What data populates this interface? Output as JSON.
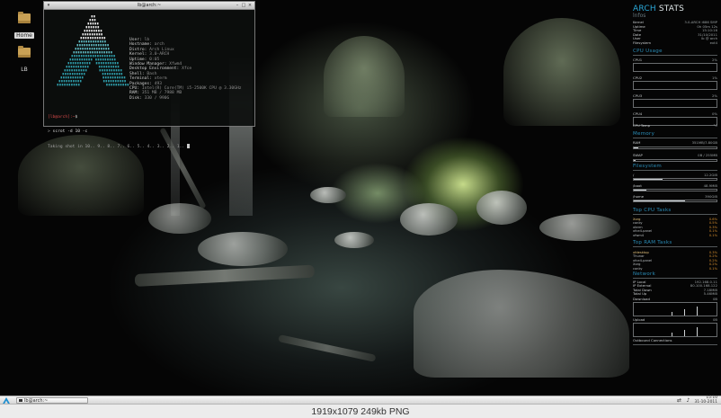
{
  "desktop": {
    "icons": [
      {
        "label": "Home"
      },
      {
        "label": "LB"
      }
    ]
  },
  "terminal": {
    "title": "lb@arch:~",
    "info": [
      {
        "key": "User:",
        "value": "lb"
      },
      {
        "key": "Hostname:",
        "value": "arch"
      },
      {
        "key": "Distro:",
        "value": "Arch Linux"
      },
      {
        "key": "Kernel:",
        "value": "3.0-ARCH"
      },
      {
        "key": "Uptime:",
        "value": "0:05"
      },
      {
        "key": "Window Manager:",
        "value": "Xfwm4"
      },
      {
        "key": "Desktop Environment:",
        "value": "Xfce"
      },
      {
        "key": "Shell:",
        "value": "Bash"
      },
      {
        "key": "Terminal:",
        "value": "xterm"
      },
      {
        "key": "Packages:",
        "value": "493"
      },
      {
        "key": "CPU:",
        "value": "Intel(R) Core(TM) i5-2500K CPU @ 3.30GHz"
      },
      {
        "key": "RAM:",
        "value": "351 MB / 7988 MB"
      },
      {
        "key": "Disk:",
        "value": "330 / 990G"
      }
    ],
    "prompt_user": "[lb@arch]:~",
    "prompt_symbol": "$",
    "command": "scrot -d 10 -c",
    "countdown": "Taking shot in 10.. 9.. 8.. 7.. 6.. 5.. 4.. 3.. 2.. 1.."
  },
  "stats": {
    "title_accent": "ARCH",
    "title_rest": "STATS",
    "host": "lnfos",
    "sys_rows": [
      {
        "k": "Kernel",
        "v": "3.0-ARCH i686 SMP"
      },
      {
        "k": "Uptime",
        "v": "0h 05m 12s"
      },
      {
        "k": "Time",
        "v": "15:10:16"
      },
      {
        "k": "Date",
        "v": "31/10/2011"
      },
      {
        "k": "User",
        "v": "lb @ arch"
      },
      {
        "k": "Filesystem",
        "v": "ext4"
      }
    ],
    "cpu_head": "CPU Usage",
    "cpu_rows": [
      {
        "k": "CPU1",
        "v": "2%"
      },
      {
        "k": "CPU2",
        "v": "1%"
      },
      {
        "k": "CPU3",
        "v": "2%"
      },
      {
        "k": "CPU4",
        "v": "0%"
      }
    ],
    "cpu_temp": {
      "k": "CPU Temp",
      "v": "°C"
    },
    "mem_head": "Memory",
    "mem_rows": [
      {
        "k": "RAM",
        "v": "351MB/7.80GB"
      },
      {
        "k": "SWAP",
        "v": "0B / 255MB"
      }
    ],
    "mem_fill": [
      0.05,
      0.0
    ],
    "fs_head": "Filesystem",
    "fs_rows": [
      {
        "k": "/",
        "v": "12.2GiB"
      },
      {
        "k": "/boot",
        "v": "48.9MiB"
      },
      {
        "k": "/home",
        "v": "390GiB"
      }
    ],
    "fs_fill": [
      0.35,
      0.15,
      0.62
    ],
    "cpu_tasks_head": "Top CPU Tasks",
    "cpu_tasks": [
      {
        "name": "Xorg",
        "pct": "0.6%"
      },
      {
        "name": "conky",
        "pct": "0.5%"
      },
      {
        "name": "xterm",
        "pct": "0.3%"
      },
      {
        "name": "xfce4-panel",
        "pct": "0.1%"
      },
      {
        "name": "xfwm4",
        "pct": "0.1%"
      }
    ],
    "mem_tasks_head": "Top RAM Tasks",
    "mem_tasks": [
      {
        "name": "xfdesktop",
        "pct": "0.3%"
      },
      {
        "name": "Thunar",
        "pct": "0.2%"
      },
      {
        "name": "xfce4-panel",
        "pct": "0.2%"
      },
      {
        "name": "Xorg",
        "pct": "0.2%"
      },
      {
        "name": "conky",
        "pct": "0.1%"
      }
    ],
    "net_head": "Network",
    "net_rows": [
      {
        "k": "IP Local",
        "v": "192.168.0.11"
      },
      {
        "k": "IP External",
        "v": "80.100.168.122"
      },
      {
        "k": "Total Down",
        "v": "7.18MiB"
      },
      {
        "k": "Total Up",
        "v": "5.46MiB"
      }
    ],
    "download": {
      "k": "Download",
      "v": "0B"
    },
    "upload": {
      "k": "Upload",
      "v": "0B"
    },
    "outbound": "Outbound Connections"
  },
  "taskbar": {
    "task_label": "lb@arch:~",
    "clock_time": "15:10",
    "clock_date": "31-10-2011"
  },
  "caption": "1919x1079  249kb  PNG",
  "icons": {
    "start": "arch-logo-icon",
    "folder": "folder-icon",
    "tray": [
      "network-icon",
      "volume-icon"
    ]
  }
}
